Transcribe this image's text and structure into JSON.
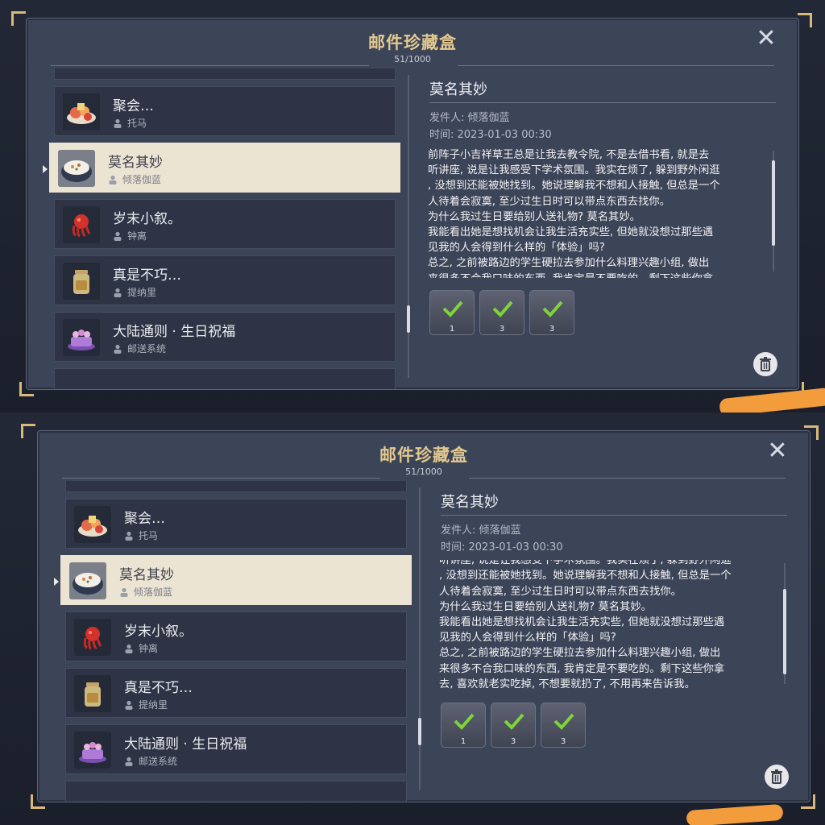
{
  "mailbox": {
    "title": "邮件珍藏盒",
    "count": "51/1000",
    "close_glyph": "✕"
  },
  "mail_list": [
    {
      "title": "聚会…",
      "sender": "托马",
      "icon": "party-food-icon"
    },
    {
      "title": "莫名其妙",
      "sender": "倾落伽蓝",
      "icon": "rice-bowl-icon",
      "selected": true
    },
    {
      "title": "岁末小叙。",
      "sender": "钟离",
      "icon": "red-octopus-icon"
    },
    {
      "title": "真是不巧…",
      "sender": "提纳里",
      "icon": "jar-icon"
    },
    {
      "title": "大陆通则 · 生日祝福",
      "sender": "邮送系统",
      "icon": "birthday-cake-icon"
    }
  ],
  "detail": {
    "title": "莫名其妙",
    "sender_line": "发件人: 倾落伽蓝",
    "time_line": "时间: 2023-01-03 00:30",
    "body_lines": [
      "前阵子小吉祥草王总是让我去教令院, 不是去借书看, 就是去",
      "听讲座, 说是让我感受下学术氛围。我实在烦了, 躲到野外闲逛",
      ", 没想到还能被她找到。她说理解我不想和人接触, 但总是一个",
      "人待着会寂寞, 至少过生日时可以带点东西去找你。",
      "为什么我过生日要给别人送礼物? 莫名其妙。",
      "我能看出她是想找机会让我生活充实些, 但她就没想过那些遇",
      "见我的人会得到什么样的「体验」吗?",
      "总之, 之前被路边的学生硬拉去参加什么料理兴趣小组, 做出",
      "来很多不合我口味的东西, 我肯定是不要吃的。剩下这些你拿",
      "去, 喜欢就老实吃掉, 不想要就扔了, 不用再来告诉我。"
    ],
    "attachments": [
      {
        "count": "1",
        "icon": "dish-check-icon"
      },
      {
        "count": "3",
        "icon": "dish-check-icon"
      },
      {
        "count": "3",
        "icon": "dish-check-icon"
      }
    ]
  },
  "colors": {
    "accent_gold": "#e3c98f",
    "panel_bg": "#3c4458",
    "selected_item_bg": "#ece4d3",
    "check_green": "#7fd43a",
    "annotation_orange": "#f39c3c"
  }
}
